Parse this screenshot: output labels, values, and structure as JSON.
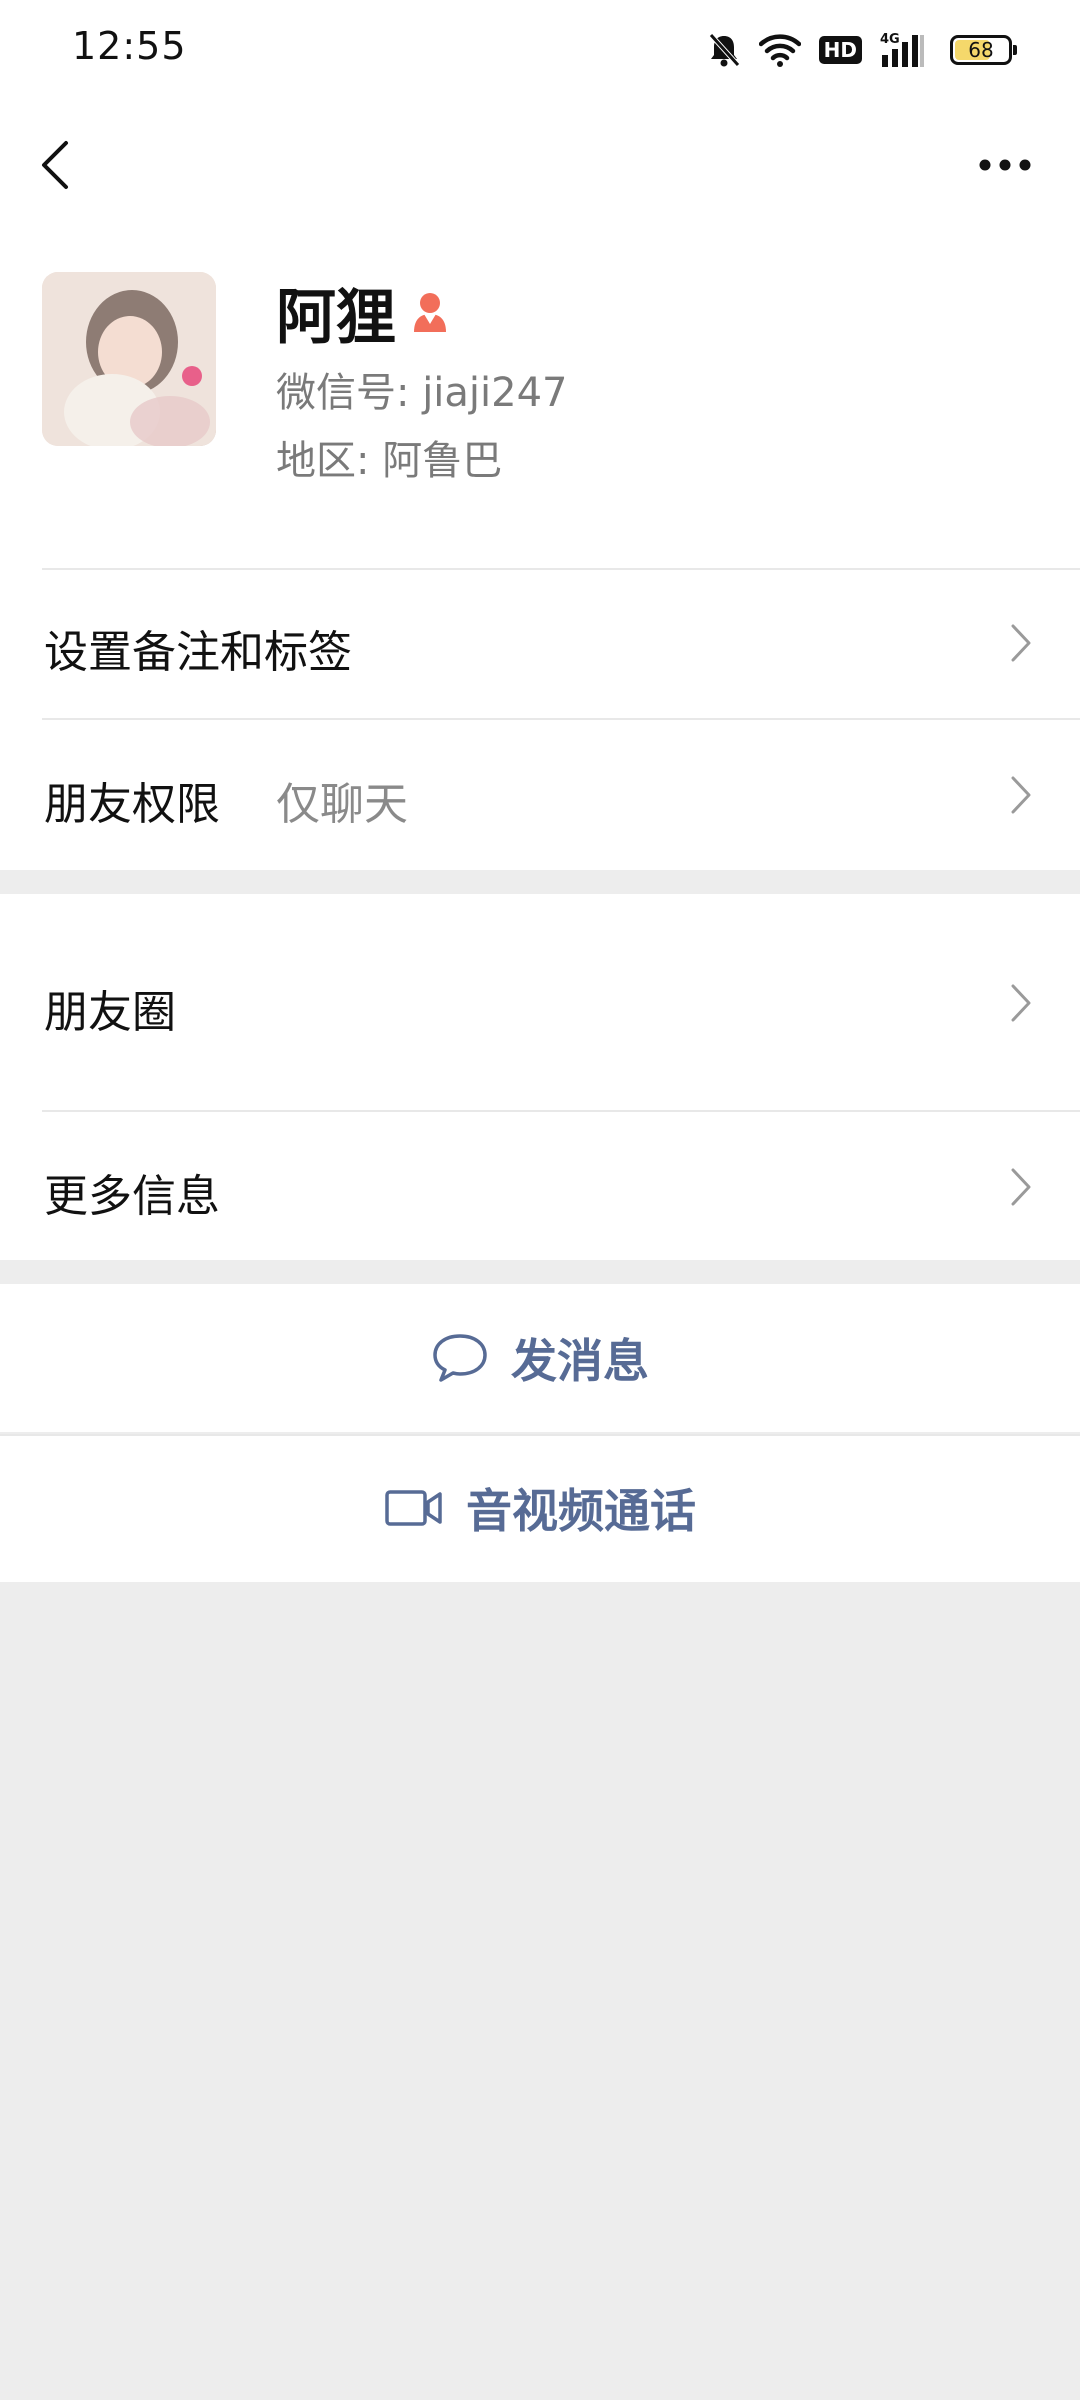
{
  "status_bar": {
    "time": "12:55",
    "network": "4G",
    "hd_label": "HD",
    "battery_level": "68",
    "battery_fraction": 0.68
  },
  "nav": {
    "back_icon": "chevron-left-icon",
    "more_icon": "ellipsis-icon"
  },
  "profile": {
    "name": "阿狸",
    "gender_icon": "female-icon",
    "gender_color": "#f26e5a",
    "wechat_id": "微信号: jiaji247",
    "region": "地区: 阿鲁巴"
  },
  "rows": {
    "remark": {
      "label": "设置备注和标签"
    },
    "permission": {
      "label": "朋友权限",
      "value": "仅聊天"
    },
    "moments": {
      "label": "朋友圈"
    },
    "more_info": {
      "label": "更多信息"
    }
  },
  "actions": {
    "message": {
      "label": "发消息",
      "icon": "chat-bubble-icon"
    },
    "call": {
      "label": "音视频通话",
      "icon": "video-camera-icon"
    }
  },
  "colors": {
    "link_blue": "#576b95",
    "background": "#ededed",
    "secondary_text": "#7a7a7a"
  }
}
